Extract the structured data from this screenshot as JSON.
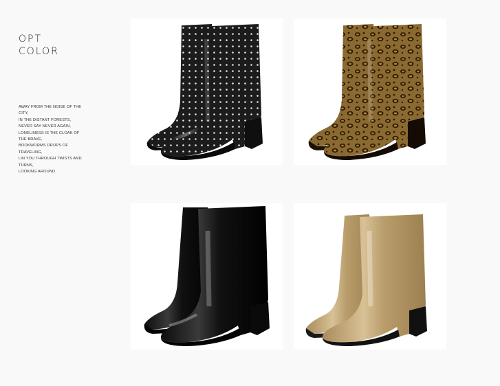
{
  "heading": {
    "line1": "OPT",
    "line2": "COLOR"
  },
  "copy": [
    "AWAY FROM THE NOISE OF THE CITY,",
    "IN THE DISTANT FORESTS,",
    "NEVER SAY NEVER AGAIN,",
    "LONELINESS IS THE CLOAK OF THE BRAVE,",
    "BOOKWORMS DROPS OF TRAVELING,",
    "LIN YOU THROUGH TWISTS AND TURNS,",
    "LOOKING AROUND"
  ],
  "products": [
    {
      "id": "polka-dot",
      "icon": "polka-dot-rain-boot-icon",
      "color": "#1a1a1a",
      "accent": "#e8e8e8"
    },
    {
      "id": "leopard",
      "icon": "leopard-rain-boot-icon",
      "color": "#6b4a1f",
      "accent": "#2a1a0a"
    },
    {
      "id": "black",
      "icon": "black-rain-boot-icon",
      "color": "#141414",
      "accent": "#555555"
    },
    {
      "id": "khaki",
      "icon": "khaki-rain-boot-icon",
      "color": "#c2a877",
      "accent": "#1a1a1a"
    }
  ]
}
